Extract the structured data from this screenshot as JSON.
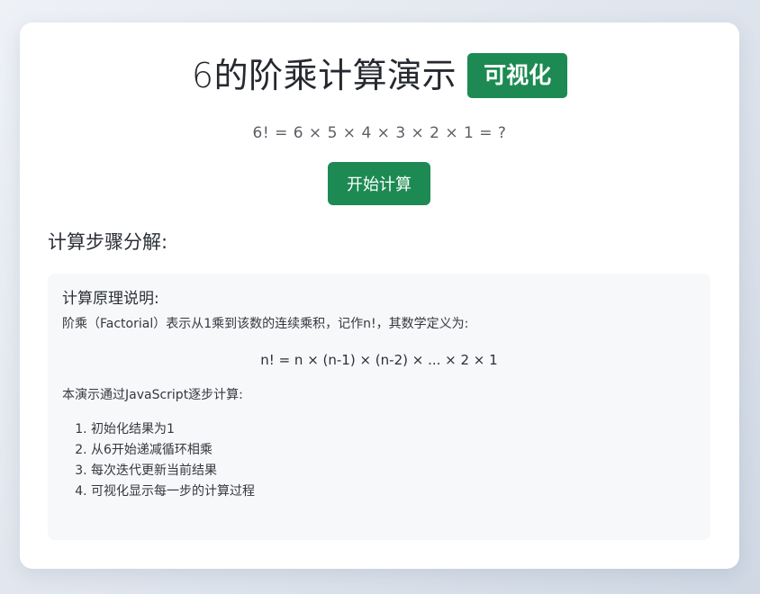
{
  "header": {
    "title": "6的阶乘计算演示",
    "badge": "可视化"
  },
  "formula": "6! = 6 × 5 × 4 × 3 × 2 × 1 = ?",
  "actions": {
    "start_label": "开始计算"
  },
  "steps_section": {
    "title": "计算步骤分解:"
  },
  "explanation": {
    "heading": "计算原理说明:",
    "definition": "阶乘（Factorial）表示从1乘到该数的连续乘积，记作n!，其数学定义为:",
    "formula": "n! = n × (n-1) × (n-2) × ... × 2 × 1",
    "method": "本演示通过JavaScript逐步计算:",
    "steps": [
      "初始化结果为1",
      "从6开始递减循环相乘",
      "每次迭代更新当前结果",
      "可视化显示每一步的计算过程"
    ]
  },
  "colors": {
    "accent": "#1c8a52"
  }
}
